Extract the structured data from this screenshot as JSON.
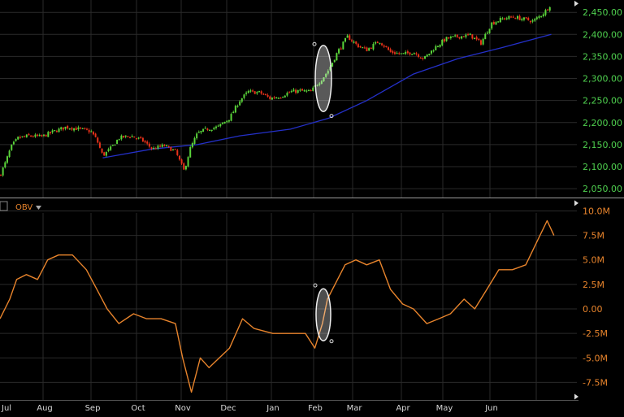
{
  "chart_data": [
    {
      "type": "candlestick",
      "title": "",
      "x_ticks": [
        "Jul",
        "Aug",
        "Sep",
        "Oct",
        "Nov",
        "Dec",
        "Jan",
        "Feb",
        "Mar",
        "Apr",
        "May",
        "Jun"
      ],
      "y_ticks": [
        "2,450.00",
        "2,400.00",
        "2,350.00",
        "2,300.00",
        "2,250.00",
        "2,200.00",
        "2,150.00",
        "2,100.00",
        "2,050.00"
      ],
      "ylim": [
        2030,
        2478
      ],
      "grid": true,
      "colors": {
        "up": "#5ad43a",
        "down": "#e8321a",
        "moving_average": "#2430c8",
        "background": "#000000",
        "grid": "#2a2a2a"
      },
      "price_path": [
        {
          "x": "Jul 1",
          "y": 2080
        },
        {
          "x": "Jul 5",
          "y": 2110
        },
        {
          "x": "Jul 9",
          "y": 2145
        },
        {
          "x": "Jul 14",
          "y": 2165
        },
        {
          "x": "Jul 22",
          "y": 2170
        },
        {
          "x": "Jul 31",
          "y": 2168
        },
        {
          "x": "Aug 8",
          "y": 2180
        },
        {
          "x": "Aug 16",
          "y": 2190
        },
        {
          "x": "Aug 25",
          "y": 2185
        },
        {
          "x": "Sep 1",
          "y": 2180
        },
        {
          "x": "Sep 5",
          "y": 2160
        },
        {
          "x": "Sep 9",
          "y": 2125
        },
        {
          "x": "Sep 14",
          "y": 2140
        },
        {
          "x": "Sep 20",
          "y": 2165
        },
        {
          "x": "Sep 28",
          "y": 2170
        },
        {
          "x": "Oct 5",
          "y": 2160
        },
        {
          "x": "Oct 12",
          "y": 2140
        },
        {
          "x": "Oct 20",
          "y": 2148
        },
        {
          "x": "Oct 28",
          "y": 2135
        },
        {
          "x": "Nov 3",
          "y": 2090
        },
        {
          "x": "Nov 7",
          "y": 2140
        },
        {
          "x": "Nov 12",
          "y": 2175
        },
        {
          "x": "Nov 18",
          "y": 2185
        },
        {
          "x": "Nov 26",
          "y": 2190
        },
        {
          "x": "Dec 3",
          "y": 2210
        },
        {
          "x": "Dec 10",
          "y": 2250
        },
        {
          "x": "Dec 16",
          "y": 2270
        },
        {
          "x": "Dec 24",
          "y": 2268
        },
        {
          "x": "Dec 31",
          "y": 2255
        },
        {
          "x": "Jan 8",
          "y": 2260
        },
        {
          "x": "Jan 15",
          "y": 2270
        },
        {
          "x": "Jan 22",
          "y": 2272
        },
        {
          "x": "Jan 30",
          "y": 2270
        },
        {
          "x": "Feb 3",
          "y": 2285
        },
        {
          "x": "Feb 8",
          "y": 2300
        },
        {
          "x": "Feb 13",
          "y": 2320
        },
        {
          "x": "Feb 20",
          "y": 2360
        },
        {
          "x": "Feb 28",
          "y": 2395
        },
        {
          "x": "Mar 4",
          "y": 2375
        },
        {
          "x": "Mar 10",
          "y": 2365
        },
        {
          "x": "Mar 18",
          "y": 2385
        },
        {
          "x": "Mar 25",
          "y": 2360
        },
        {
          "x": "Apr 2",
          "y": 2355
        },
        {
          "x": "Apr 10",
          "y": 2360
        },
        {
          "x": "Apr 18",
          "y": 2345
        },
        {
          "x": "Apr 26",
          "y": 2370
        },
        {
          "x": "May 3",
          "y": 2390
        },
        {
          "x": "May 11",
          "y": 2395
        },
        {
          "x": "May 19",
          "y": 2398
        },
        {
          "x": "May 26",
          "y": 2380
        },
        {
          "x": "Jun 2",
          "y": 2425
        },
        {
          "x": "Jun 9",
          "y": 2435
        },
        {
          "x": "Jun 16",
          "y": 2440
        },
        {
          "x": "Jun 23",
          "y": 2435
        },
        {
          "x": "Jun 30",
          "y": 2430
        },
        {
          "x": "Jul 7",
          "y": 2450
        },
        {
          "x": "Jul 12",
          "y": 2470
        }
      ],
      "moving_average": [
        {
          "x": "Sep 9",
          "y": 2120
        },
        {
          "x": "Oct 12",
          "y": 2140
        },
        {
          "x": "Nov 12",
          "y": 2150
        },
        {
          "x": "Dec 10",
          "y": 2170
        },
        {
          "x": "Jan 15",
          "y": 2185
        },
        {
          "x": "Feb 13",
          "y": 2210
        },
        {
          "x": "Mar 10",
          "y": 2250
        },
        {
          "x": "Apr 10",
          "y": 2310
        },
        {
          "x": "May 11",
          "y": 2345
        },
        {
          "x": "Jun 9",
          "y": 2370
        },
        {
          "x": "Jul 12",
          "y": 2400
        }
      ]
    },
    {
      "type": "line",
      "title": "",
      "legend": "OBV",
      "x_ticks": [
        "Jul",
        "Aug",
        "Sep",
        "Oct",
        "Nov",
        "Dec",
        "Jan",
        "Feb",
        "Mar",
        "Apr",
        "May",
        "Jun"
      ],
      "y_ticks": [
        "10.0M",
        "7.5M",
        "5.0M",
        "2.5M",
        "0.00",
        "-2.5M",
        "-5.0M",
        "-7.5M"
      ],
      "ylim": [
        -10.7,
        11.2
      ],
      "unit": "M",
      "grid": true,
      "colors": {
        "line": "#e8842c",
        "background": "#000000",
        "grid": "#2a2a2a"
      },
      "series": [
        {
          "points": [
            {
              "x": "Jul 1",
              "y": -1.0
            },
            {
              "x": "Jul 8",
              "y": 1.0
            },
            {
              "x": "Jul 13",
              "y": 3.0
            },
            {
              "x": "Jul 20",
              "y": 3.5
            },
            {
              "x": "Jul 28",
              "y": 3.0
            },
            {
              "x": "Aug 4",
              "y": 5.0
            },
            {
              "x": "Aug 11",
              "y": 5.5
            },
            {
              "x": "Aug 20",
              "y": 5.5
            },
            {
              "x": "Aug 29",
              "y": 4.0
            },
            {
              "x": "Sep 5",
              "y": 2.0
            },
            {
              "x": "Sep 12",
              "y": 0.0
            },
            {
              "x": "Sep 20",
              "y": -1.5
            },
            {
              "x": "Sep 30",
              "y": -0.5
            },
            {
              "x": "Oct 8",
              "y": -1.0
            },
            {
              "x": "Oct 18",
              "y": -1.0
            },
            {
              "x": "Oct 28",
              "y": -1.5
            },
            {
              "x": "Nov 2",
              "y": -5.0
            },
            {
              "x": "Nov 8",
              "y": -8.5
            },
            {
              "x": "Nov 14",
              "y": -5.0
            },
            {
              "x": "Nov 20",
              "y": -6.0
            },
            {
              "x": "Dec 3",
              "y": -4.0
            },
            {
              "x": "Dec 12",
              "y": -1.0
            },
            {
              "x": "Dec 20",
              "y": -2.0
            },
            {
              "x": "Jan 2",
              "y": -2.5
            },
            {
              "x": "Jan 15",
              "y": -2.5
            },
            {
              "x": "Jan 26",
              "y": -2.5
            },
            {
              "x": "Feb 2",
              "y": -4.0
            },
            {
              "x": "Feb 8",
              "y": -1.5
            },
            {
              "x": "Feb 12",
              "y": 1.0
            },
            {
              "x": "Feb 18",
              "y": 2.5
            },
            {
              "x": "Feb 26",
              "y": 4.5
            },
            {
              "x": "Mar 3",
              "y": 5.0
            },
            {
              "x": "Mar 10",
              "y": 4.5
            },
            {
              "x": "Mar 18",
              "y": 5.0
            },
            {
              "x": "Mar 25",
              "y": 2.0
            },
            {
              "x": "Apr 2",
              "y": 0.5
            },
            {
              "x": "Apr 10",
              "y": 0.0
            },
            {
              "x": "Apr 20",
              "y": -1.5
            },
            {
              "x": "Apr 29",
              "y": -1.0
            },
            {
              "x": "May 6",
              "y": -0.5
            },
            {
              "x": "May 15",
              "y": 1.0
            },
            {
              "x": "May 22",
              "y": 0.0
            },
            {
              "x": "May 30",
              "y": 2.0
            },
            {
              "x": "Jun 7",
              "y": 4.0
            },
            {
              "x": "Jun 16",
              "y": 4.0
            },
            {
              "x": "Jun 25",
              "y": 4.5
            },
            {
              "x": "Jul 2",
              "y": 7.0
            },
            {
              "x": "Jul 9",
              "y": 9.0
            },
            {
              "x": "Jul 14",
              "y": 7.5
            }
          ]
        }
      ]
    }
  ],
  "annotations": [
    "highlight-price-feb",
    "highlight-obv-feb"
  ]
}
